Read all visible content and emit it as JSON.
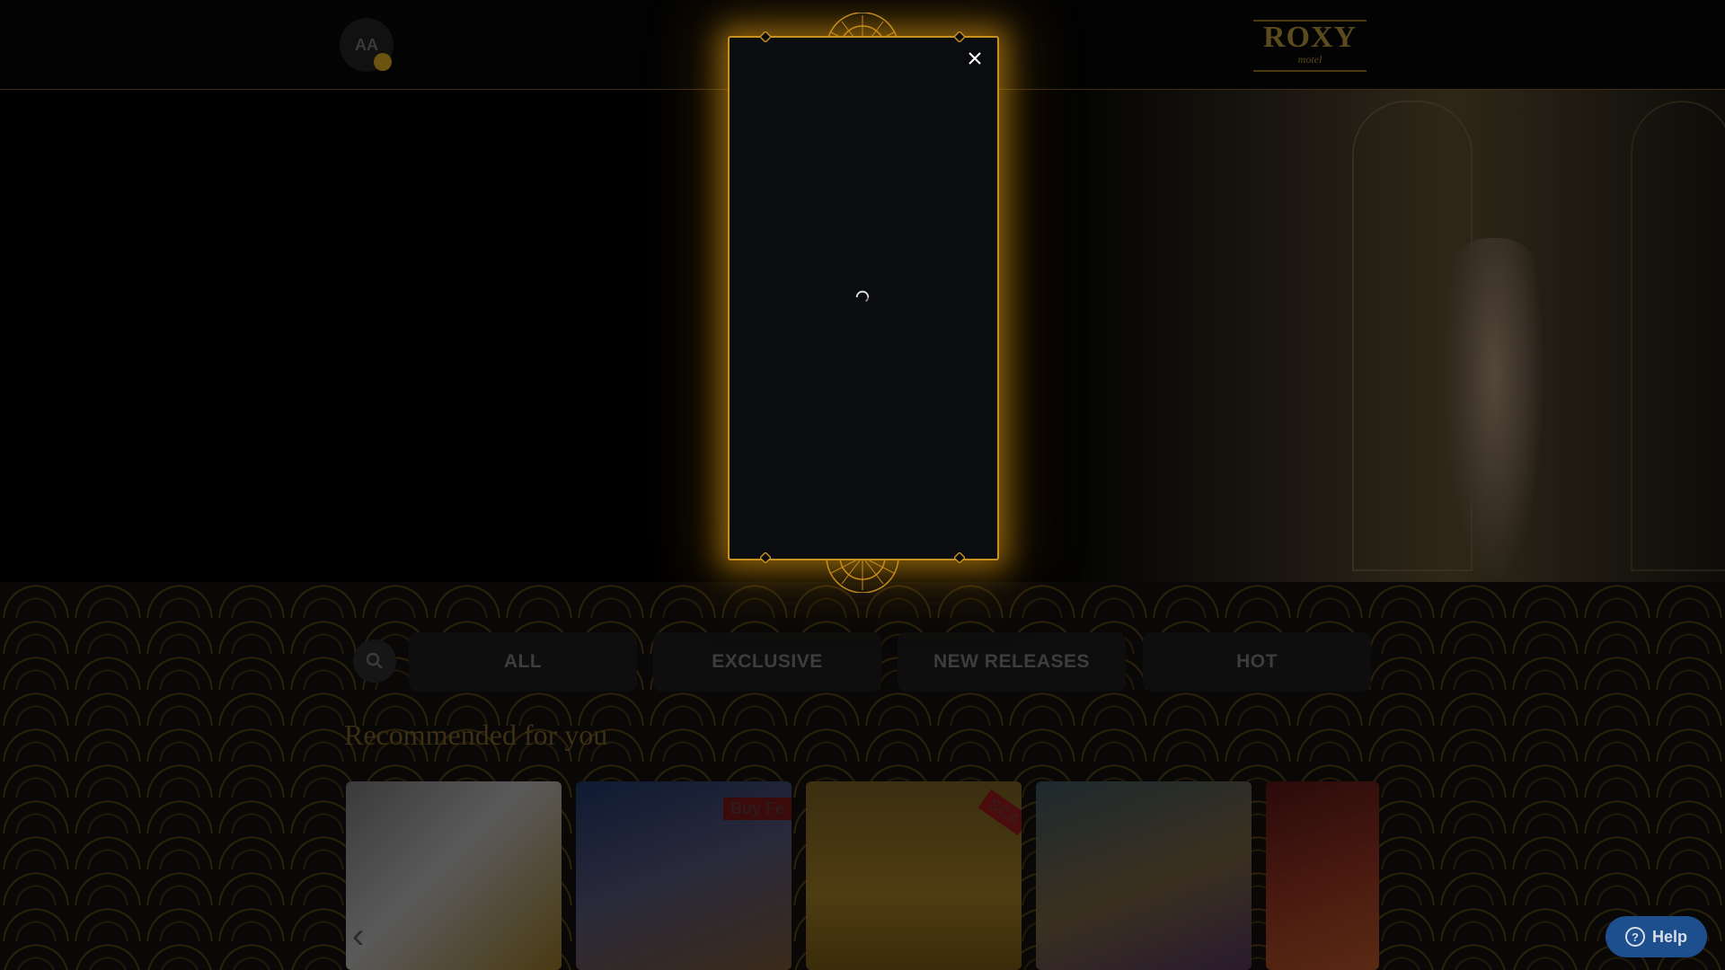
{
  "header": {
    "avatar_initials": "AA",
    "logo_line1": "ROXY",
    "logo_line2": "motel"
  },
  "category_tabs": [
    {
      "label": "ALL"
    },
    {
      "label": "EXCLUSIVE"
    },
    {
      "label": "NEW RELEASES"
    },
    {
      "label": "HOT"
    }
  ],
  "recommended": {
    "title": "Recommended for you",
    "games": [
      {
        "name": "game-tile-lion",
        "badge": ""
      },
      {
        "name": "game-tile-warrior",
        "badge": "Buy Fe"
      },
      {
        "name": "game-tile-gates",
        "badge": "SCA"
      },
      {
        "name": "game-tile-owl",
        "badge": ""
      },
      {
        "name": "game-tile-woman",
        "badge": ""
      }
    ]
  },
  "help": {
    "label": "Help"
  },
  "icons": {
    "close": "close-icon",
    "spinner": "loading-spinner-icon",
    "search": "search-icon",
    "help": "question-mark-icon"
  },
  "colors": {
    "modal_border": "#c8901e",
    "modal_glow": "#d79614",
    "help_button": "#1d4f8f"
  }
}
